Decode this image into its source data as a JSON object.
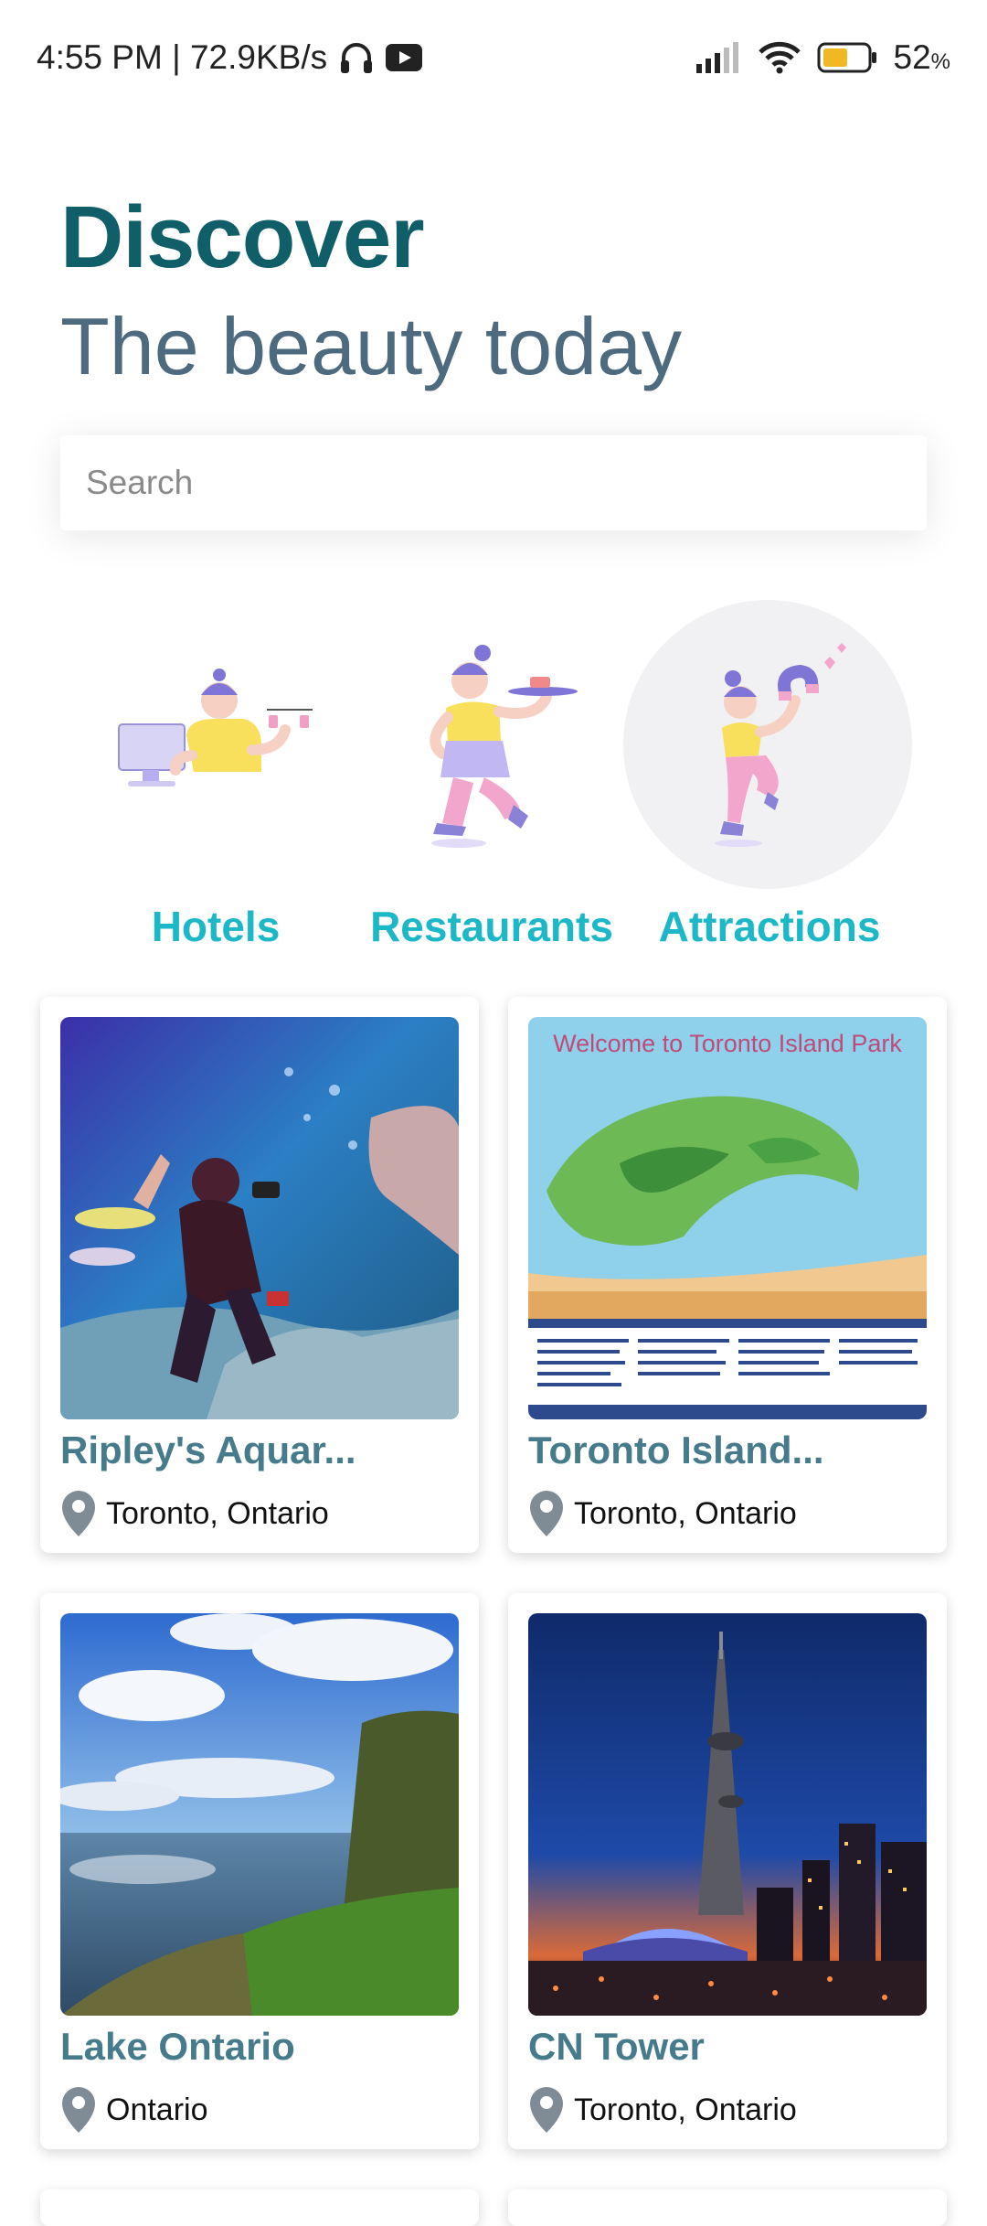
{
  "status_bar": {
    "time_net": "4:55 PM | 72.9KB/s",
    "battery": "52",
    "battery_unit": "%"
  },
  "header": {
    "title": "Discover",
    "subtitle": "The beauty today"
  },
  "search": {
    "placeholder": "Search",
    "value": ""
  },
  "categories": [
    {
      "label": "Hotels",
      "selected": false
    },
    {
      "label": "Restaurants",
      "selected": false
    },
    {
      "label": "Attractions",
      "selected": true
    }
  ],
  "places": [
    {
      "name": "Ripley's Aquar...",
      "location": "Toronto, Ontario"
    },
    {
      "name": "Toronto Island...",
      "location": "Toronto, Ontario",
      "image_text": "Welcome to Toronto Island Park"
    },
    {
      "name": "Lake Ontario",
      "location": "Ontario"
    },
    {
      "name": "CN Tower",
      "location": "Toronto, Ontario"
    }
  ],
  "colors": {
    "title": "#0f5e68",
    "subtitle": "#4d6a7e",
    "category_label": "#1cb8c8",
    "card_title": "#467b8c"
  }
}
